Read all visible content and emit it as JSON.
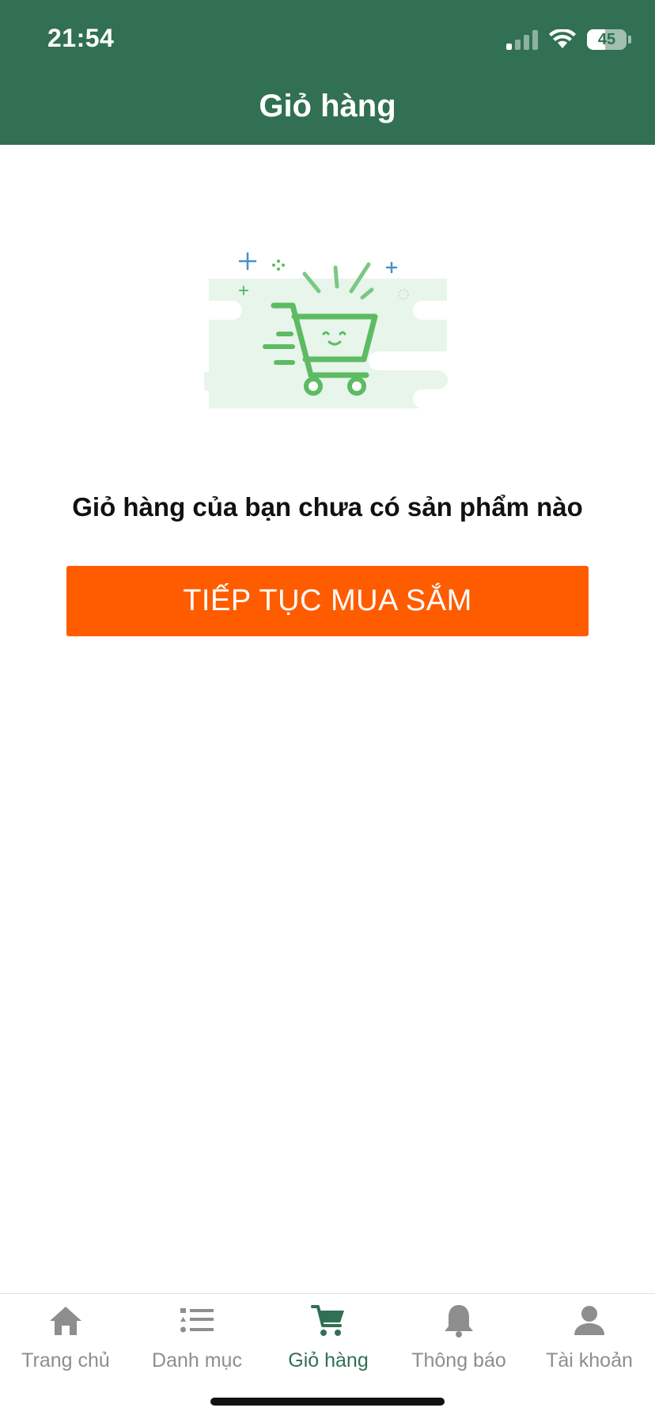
{
  "status_bar": {
    "time": "21:54",
    "battery": "45"
  },
  "header": {
    "title": "Giỏ hàng"
  },
  "empty_state": {
    "illustration_icon": "shopping-cart-icon",
    "message": "Giỏ hàng của bạn chưa có sản phẩm nào",
    "button_label": "TIẾP TỤC MUA SẮM"
  },
  "tabs": [
    {
      "label": "Trang chủ",
      "icon": "home-icon",
      "active": false
    },
    {
      "label": "Danh mục",
      "icon": "list-icon",
      "active": false
    },
    {
      "label": "Giỏ hàng",
      "icon": "cart-icon",
      "active": true
    },
    {
      "label": "Thông báo",
      "icon": "bell-icon",
      "active": false
    },
    {
      "label": "Tài khoản",
      "icon": "user-icon",
      "active": false
    }
  ],
  "colors": {
    "header": "#317052",
    "accent_button": "#ff5c00",
    "illustration_green": "#5dbb63",
    "inactive_tab": "#8e8e8e"
  }
}
